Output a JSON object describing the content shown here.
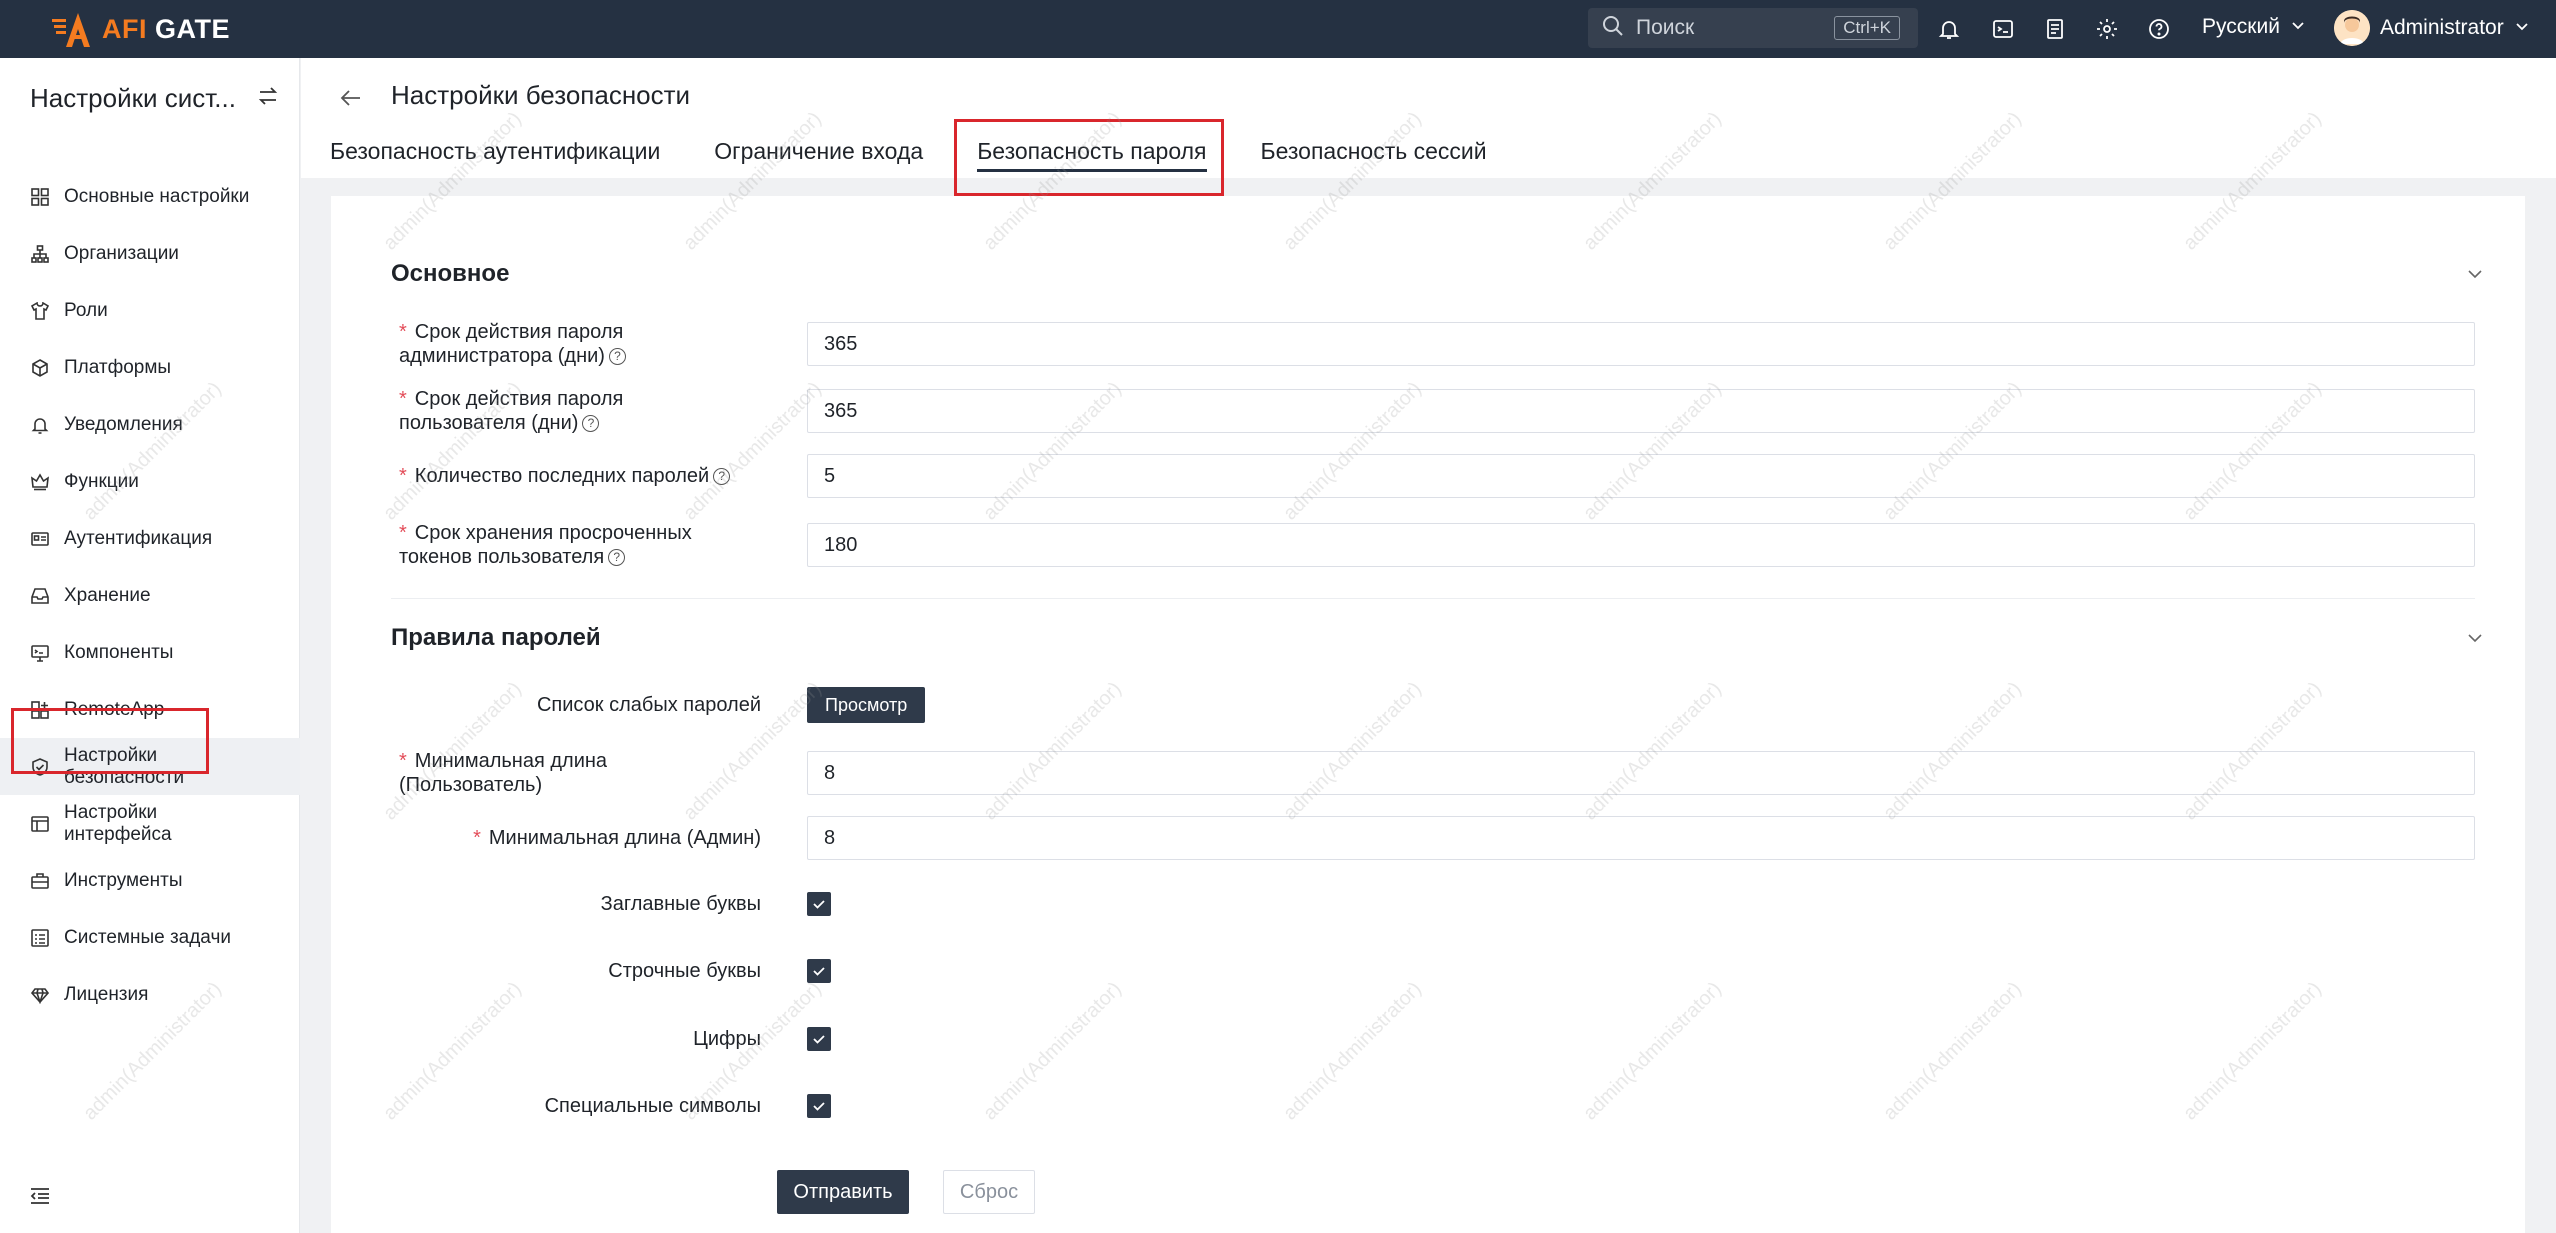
{
  "app": {
    "logo_text_prefix": "AFI",
    "logo_text_suffix": "GATE"
  },
  "topbar": {
    "search_placeholder": "Поиск",
    "search_shortcut": "Ctrl+K",
    "icons": [
      "bell-icon",
      "terminal-icon",
      "clipboard-icon",
      "gear-icon",
      "help-icon"
    ],
    "language": "Русский",
    "user_name": "Administrator"
  },
  "sidebar": {
    "title": "Настройки сист...",
    "items": [
      {
        "label": "Основные настройки",
        "icon": "grid-icon"
      },
      {
        "label": "Организации",
        "icon": "org-icon"
      },
      {
        "label": "Роли",
        "icon": "shirt-icon"
      },
      {
        "label": "Платформы",
        "icon": "cube-icon"
      },
      {
        "label": "Уведомления",
        "icon": "bell-icon"
      },
      {
        "label": "Функции",
        "icon": "crown-icon"
      },
      {
        "label": "Аутентификация",
        "icon": "id-card-icon"
      },
      {
        "label": "Хранение",
        "icon": "inbox-icon"
      },
      {
        "label": "Компоненты",
        "icon": "monitor-icon"
      },
      {
        "label": "RemoteApp",
        "icon": "apps-icon"
      },
      {
        "label_line1": "Настройки",
        "label_line2": "безопасности",
        "icon": "shield-icon",
        "active": true
      },
      {
        "label_line1": "Настройки",
        "label_line2": "интерфейса",
        "icon": "window-icon"
      },
      {
        "label": "Инструменты",
        "icon": "toolbox-icon"
      },
      {
        "label": "Системные задачи",
        "icon": "tasks-icon"
      },
      {
        "label": "Лицензия",
        "icon": "diamond-icon"
      }
    ]
  },
  "header": {
    "title": "Настройки безопасности",
    "tabs": [
      {
        "label": "Безопасность аутентификации"
      },
      {
        "label": "Ограничение входа"
      },
      {
        "label": "Безопасность пароля",
        "active": true
      },
      {
        "label": "Безопасность сессий"
      }
    ]
  },
  "form": {
    "basic": {
      "title": "Основное",
      "admin_expiry": {
        "label_line1": "Срок действия пароля",
        "label_line2": "администратора (дни)",
        "value": "365"
      },
      "user_expiry": {
        "label_line1": "Срок действия пароля",
        "label_line2": "пользователя (дни)",
        "value": "365"
      },
      "history": {
        "label": "Количество последних паролей",
        "value": "5"
      },
      "token_retention": {
        "label_line1": "Срок хранения просроченных",
        "label_line2": "токенов пользователя",
        "value": "180"
      }
    },
    "rules": {
      "title": "Правила паролей",
      "weak_list": {
        "label": "Список слабых паролей",
        "button": "Просмотр"
      },
      "min_user": {
        "label_line1": "Минимальная длина",
        "label_line2": "(Пользователь)",
        "value": "8"
      },
      "min_admin": {
        "label": "Минимальная длина (Админ)",
        "value": "8"
      },
      "upper": {
        "label": "Заглавные буквы",
        "checked": true
      },
      "lower": {
        "label": "Строчные буквы",
        "checked": true
      },
      "digits": {
        "label": "Цифры",
        "checked": true
      },
      "special": {
        "label": "Специальные символы",
        "checked": true
      }
    },
    "submit": "Отправить",
    "reset": "Сброс"
  },
  "watermark": "admin(Administrator)",
  "colors": {
    "topbar": "#253142",
    "accent": "#f47b20",
    "highlight": "#d9262c",
    "primary_button": "#2f3a4a"
  }
}
